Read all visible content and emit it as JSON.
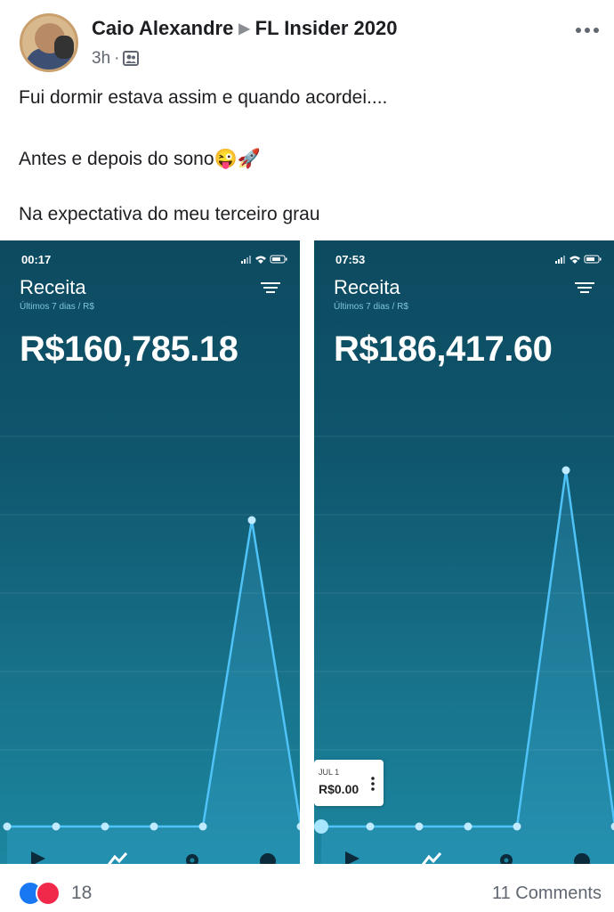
{
  "post": {
    "author": "Caio Alexandre",
    "group": "FL Insider 2020",
    "time": "3h",
    "dot": "·",
    "text_lines": [
      "Fui dormir estava assim e quando acordei....",
      "Antes e depois do sono😜🚀",
      "Na expectativa do meu terceiro grau"
    ]
  },
  "screenshots": [
    {
      "status_time": "00:17",
      "title": "Receita",
      "subtitle": "Últimos 7 dias / R$",
      "amount": "R$160,785.18",
      "chart_data": {
        "type": "line",
        "points": [
          0,
          0,
          0,
          0,
          0,
          1,
          0
        ]
      }
    },
    {
      "status_time": "07:53",
      "title": "Receita",
      "subtitle": "Últimos 7 dias / R$",
      "amount": "R$186,417.60",
      "tooltip": {
        "date": "JUL 1",
        "value": "R$0.00"
      },
      "chart_data": {
        "type": "line",
        "points": [
          0,
          0,
          0,
          0,
          0,
          1,
          0
        ]
      }
    }
  ],
  "footer": {
    "reaction_count": "18",
    "comments": "11 Comments"
  },
  "colors": {
    "chart_line": "#4fc3f7",
    "accent_like": "#1877f2",
    "accent_love": "#f0284a"
  },
  "icons": [
    "more-icon",
    "group-icon",
    "filter-icon",
    "play-icon",
    "trend-icon",
    "gear-icon",
    "avatar-ca-icon",
    "like-icon",
    "love-icon"
  ]
}
